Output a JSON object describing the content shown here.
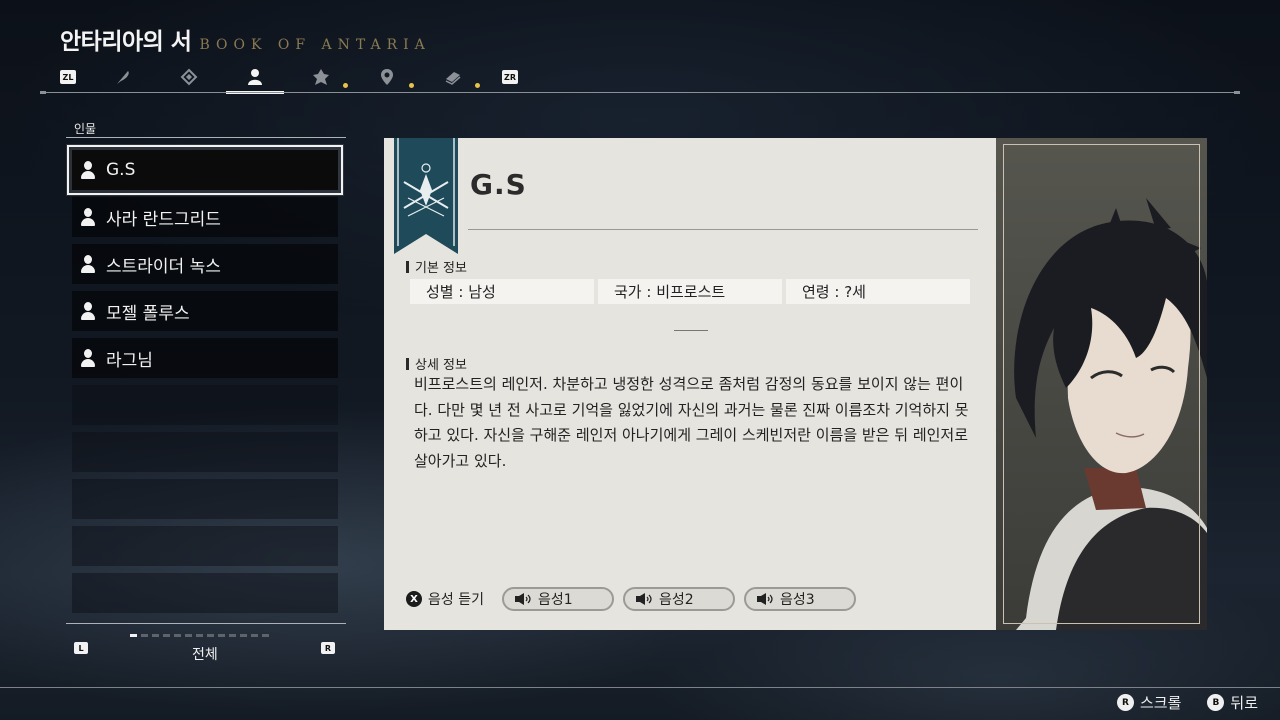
{
  "header": {
    "title": "안타리아의 서",
    "subtitle": "BOOK OF ANTARIA",
    "left_trigger": "ZL",
    "right_trigger": "ZR",
    "tabs": [
      {
        "icon": "feather-icon",
        "active": false,
        "new": false
      },
      {
        "icon": "diamond-icon",
        "active": false,
        "new": false
      },
      {
        "icon": "person-icon",
        "active": true,
        "new": false
      },
      {
        "icon": "crest-icon",
        "active": false,
        "new": true
      },
      {
        "icon": "map-pin-icon",
        "active": false,
        "new": true
      },
      {
        "icon": "book-icon",
        "active": false,
        "new": true
      }
    ],
    "new_dot_color": "#e8c24a"
  },
  "list": {
    "label": "인물",
    "items": [
      "G.S",
      "사라 란드그리드",
      "스트라이더 녹스",
      "모젤 폴루스",
      "라그님"
    ],
    "selected_index": 0,
    "left_bumper": "L",
    "right_bumper": "R",
    "filter": "전체"
  },
  "card": {
    "name": "G.S",
    "basic_info_title": "기본 정보",
    "gender": "성별 : 남성",
    "nation": "국가 : 비프로스트",
    "age": "연령 : ?세",
    "detail_title": "상세 정보",
    "description": "비프로스트의 레인저. 차분하고 냉정한 성격으로 좀처럼 감정의 동요를 보이지 않는 편이다. 다만 몇 년 전 사고로 기억을 잃었기에 자신의 과거는 물론 진짜 이름조차 기억하지 못하고 있다. 자신을 구해준 레인저 아나기에게 그레이 스케빈저란 이름을 받은 뒤 레인저로 살아가고 있다.",
    "voice_button": "X",
    "voice_label": "음성 듣기",
    "voices": [
      "음성1",
      "음성2",
      "음성3"
    ],
    "banner_color": "#1e4a5a"
  },
  "footer": {
    "scroll_button": "R",
    "scroll_label": "스크롤",
    "back_button": "B",
    "back_label": "뒤로"
  }
}
